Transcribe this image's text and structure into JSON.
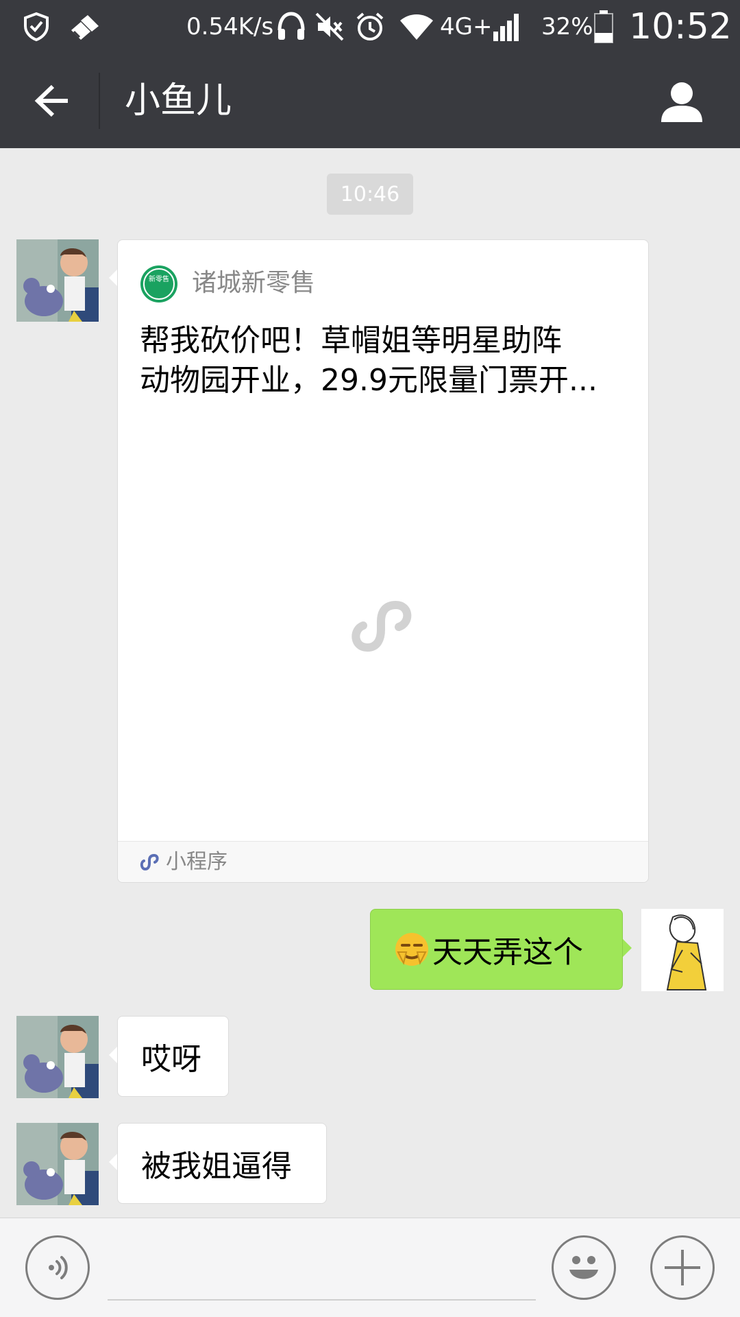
{
  "status_bar": {
    "network_speed": "0.54K/s",
    "network_type": "4G+",
    "battery": "32%",
    "time": "10:52",
    "icons": [
      "shield-icon",
      "broom-icon",
      "headset-icon",
      "mute-icon",
      "alarm-icon",
      "wifi-icon",
      "signal-icon",
      "battery-icon"
    ]
  },
  "header": {
    "title": "小鱼儿",
    "back_icon": "arrow-left-icon",
    "profile_icon": "person-icon",
    "background": "#393a3f"
  },
  "chat": {
    "timestamp": "10:46",
    "messages": [
      {
        "type": "mini-program",
        "sender": "other",
        "source": "诸城新零售",
        "logo_text": "新零售",
        "title_line1": "帮我砍价吧！草帽姐等明星助阵",
        "title_line2": "动物园开业，29.9元限量门票开...",
        "footer_label": "小程序"
      },
      {
        "type": "text",
        "sender": "me",
        "emoji": "smirk-emoji",
        "text": "天天弄这个"
      },
      {
        "type": "text",
        "sender": "other",
        "text": "哎呀"
      },
      {
        "type": "text",
        "sender": "other",
        "text": "被我姐逼得"
      }
    ]
  },
  "input_bar": {
    "voice_icon": "voice-icon",
    "emoji_icon": "smiley-icon",
    "plus_icon": "plus-icon"
  },
  "colors": {
    "my_bubble": "#9fe658",
    "other_bubble": "#ffffff",
    "chat_background": "#ebebeb",
    "mini_program_logo": "#1aa260"
  }
}
